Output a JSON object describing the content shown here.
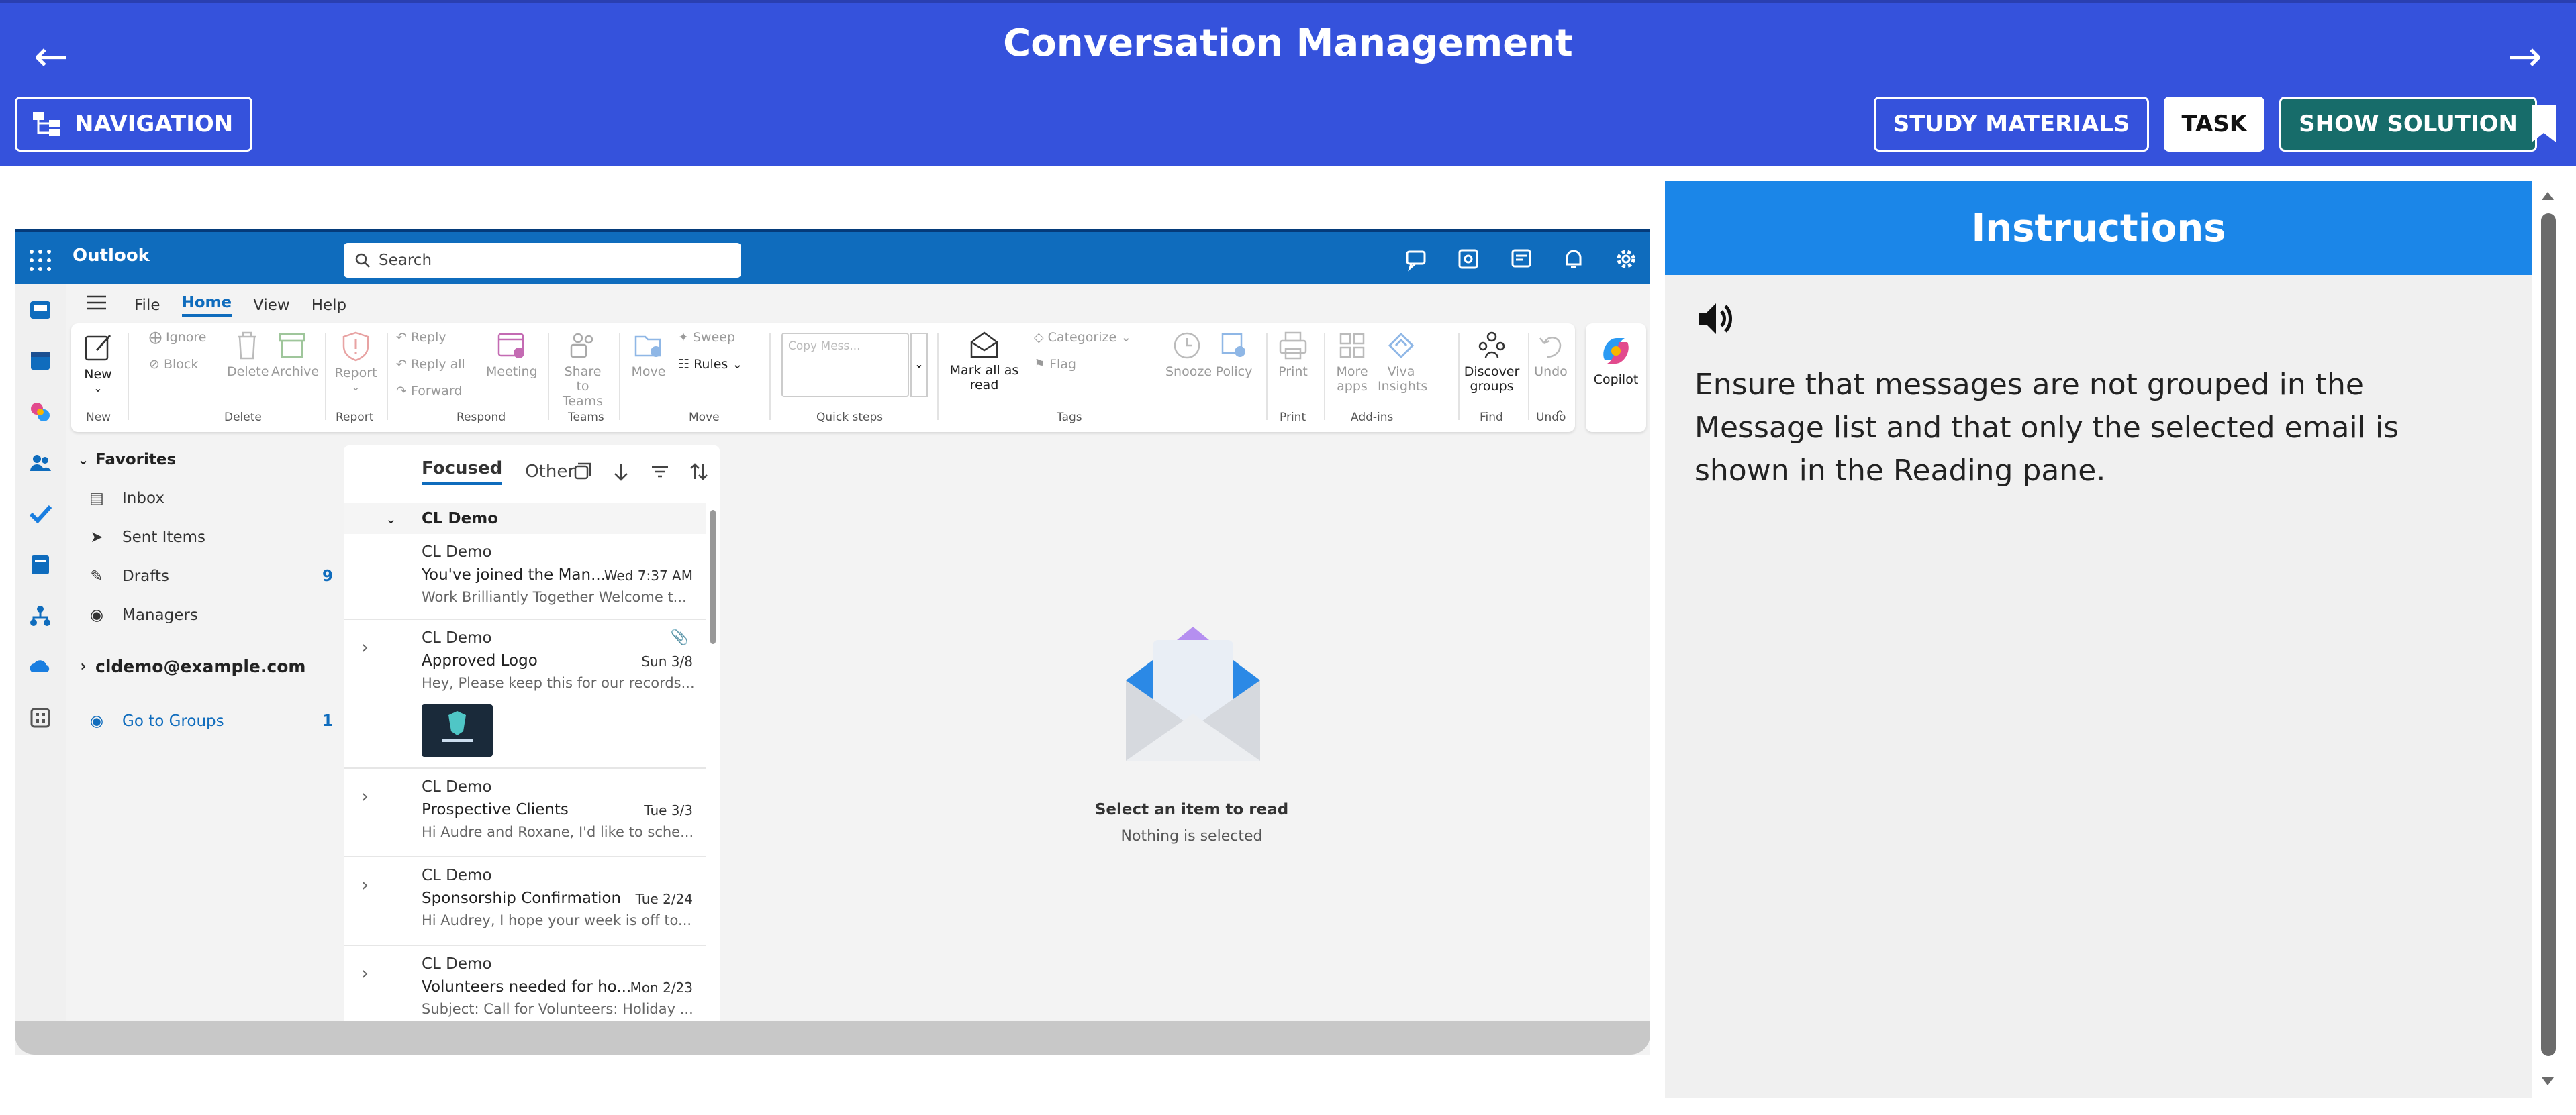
{
  "header": {
    "title": "Conversation Management",
    "navigation_label": "NAVIGATION",
    "study_materials_label": "STUDY MATERIALS",
    "task_label": "TASK",
    "show_solution_label": "SHOW SOLUTION"
  },
  "outlook": {
    "app_name": "Outlook",
    "search_placeholder": "Search",
    "menu_tabs": [
      "File",
      "Home",
      "View",
      "Help"
    ],
    "ribbon": {
      "new": "New",
      "ignore": "Ignore",
      "block": "Block",
      "delete": "Delete",
      "archive": "Archive",
      "report": "Report",
      "reply": "Reply",
      "reply_all": "Reply all",
      "forward": "Forward",
      "meeting": "Meeting",
      "share_to_teams_1": "Share to",
      "share_to_teams_2": "Teams",
      "move": "Move",
      "sweep": "Sweep",
      "rules": "Rules",
      "copy_message": "Copy Mess...",
      "mark_all_read_1": "Mark all as",
      "mark_all_read_2": "read",
      "categorize": "Categorize",
      "flag": "Flag",
      "snooze": "Snooze",
      "policy": "Policy",
      "print": "Print",
      "more_apps_1": "More",
      "more_apps_2": "apps",
      "viva_1": "Viva",
      "viva_2": "Insights",
      "discover_1": "Discover",
      "discover_2": "groups",
      "undo": "Undo",
      "copilot": "Copilot",
      "groups": {
        "new": "New",
        "delete": "Delete",
        "report": "Report",
        "respond": "Respond",
        "teams": "Teams",
        "move": "Move",
        "quick_steps": "Quick steps",
        "tags": "Tags",
        "print": "Print",
        "addins": "Add-ins",
        "find": "Find",
        "undo": "Undo"
      }
    },
    "folders": {
      "favorites": "Favorites",
      "inbox": "Inbox",
      "sent": "Sent Items",
      "drafts": "Drafts",
      "drafts_count": "9",
      "managers": "Managers",
      "account": "cldemo@example.com",
      "groups": "Go to Groups",
      "groups_count": "1"
    },
    "list": {
      "focused": "Focused",
      "other": "Other",
      "group_header": "CL Demo",
      "messages": [
        {
          "sender": "CL Demo",
          "subject": "You've joined the Man...",
          "date": "Wed 7:37 AM",
          "preview": "Work Brilliantly Together Welcome t..."
        },
        {
          "sender": "CL Demo",
          "subject": "Approved Logo",
          "date": "Sun 3/8",
          "preview": "Hey, Please keep this for our records..."
        },
        {
          "sender": "CL Demo",
          "subject": "Prospective Clients",
          "date": "Tue 3/3",
          "preview": "Hi Audre and Roxane, I'd like to sche..."
        },
        {
          "sender": "CL Demo",
          "subject": "Sponsorship Confirmation",
          "date": "Tue 2/24",
          "preview": "Hi Audrey, I hope your week is off to..."
        },
        {
          "sender": "CL Demo",
          "subject": "Volunteers needed for ho...",
          "date": "Mon 2/23",
          "preview": "Subject: Call for Volunteers: Holiday ..."
        }
      ]
    },
    "reading": {
      "title": "Select an item to read",
      "subtitle": "Nothing is selected"
    }
  },
  "instructions": {
    "heading": "Instructions",
    "text": "Ensure that messages are not grouped in the Message list and that only the selected email is shown in the Reading pane."
  },
  "colors": {
    "header_blue": "#3552dc",
    "outlook_blue": "#0f6cbd",
    "instructions_blue": "#1b86e8",
    "solution_green": "#176c6a"
  }
}
